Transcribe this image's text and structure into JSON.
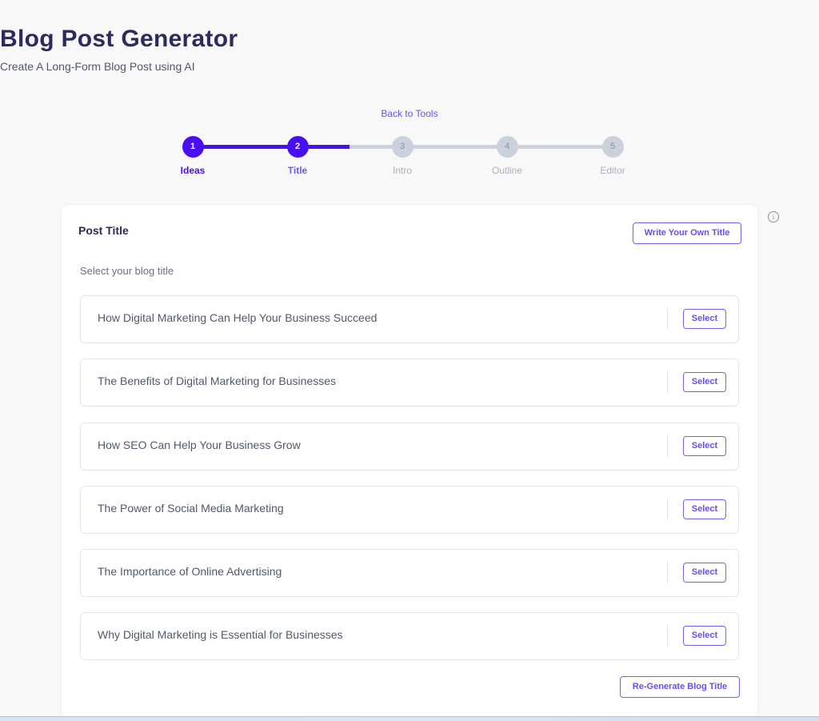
{
  "header": {
    "title": "Blog Post Generator",
    "subtitle": "Create A Long-Form Blog Post using AI",
    "back_link": "Back to Tools"
  },
  "stepper": {
    "current_step": 2,
    "total_steps": 5,
    "steps": [
      {
        "number": "1",
        "label": "Ideas",
        "state": "completed"
      },
      {
        "number": "2",
        "label": "Title",
        "state": "current"
      },
      {
        "number": "3",
        "label": "Intro",
        "state": "inactive"
      },
      {
        "number": "4",
        "label": "Outline",
        "state": "inactive"
      },
      {
        "number": "5",
        "label": "Editor",
        "state": "inactive"
      }
    ]
  },
  "card": {
    "title": "Post Title",
    "write_own_label": "Write Your Own Title",
    "hint": "Select your blog title",
    "options": [
      {
        "text": "How Digital Marketing Can Help Your Business Succeed",
        "button": "Select"
      },
      {
        "text": "The Benefits of Digital Marketing for Businesses",
        "button": "Select"
      },
      {
        "text": "How SEO Can Help Your Business Grow",
        "button": "Select"
      },
      {
        "text": "The Power of Social Media Marketing",
        "button": "Select"
      },
      {
        "text": "The Importance of Online Advertising",
        "button": "Select"
      },
      {
        "text": "Why Digital Marketing is Essential for Businesses",
        "button": "Select"
      }
    ],
    "regenerate_label": "Re-Generate Blog Title"
  },
  "icons": {
    "info": "i"
  },
  "colors": {
    "accent": "#4a0ff0",
    "button_text": "#6c4cf0",
    "title": "#2b2b5e",
    "inactive_step": "#cbd1dc"
  }
}
